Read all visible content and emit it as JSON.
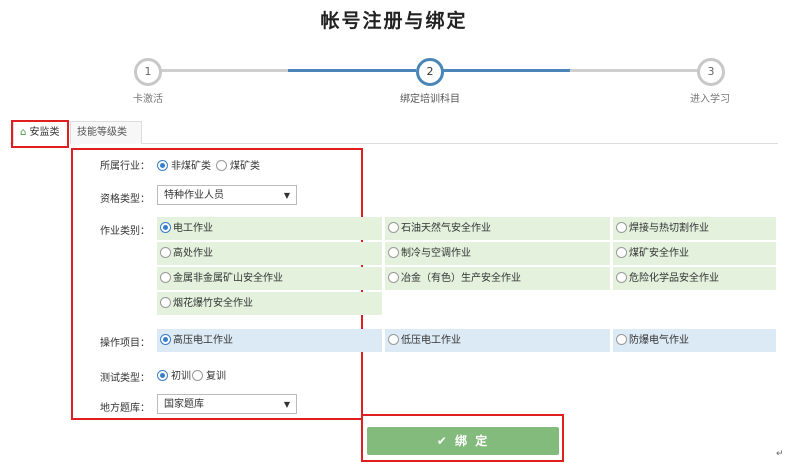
{
  "page": {
    "title": "帐号注册与绑定"
  },
  "steps": [
    {
      "num": "1",
      "label": "卡激活"
    },
    {
      "num": "2",
      "label": "绑定培训科目"
    },
    {
      "num": "3",
      "label": "进入学习"
    }
  ],
  "tabs": [
    {
      "label": "安监类",
      "icon": "home-icon"
    },
    {
      "label": "技能等级类"
    }
  ],
  "form": {
    "industry": {
      "label": "所属行业：",
      "options": [
        "非煤矿类",
        "煤矿类"
      ],
      "selected": "非煤矿类"
    },
    "qualification": {
      "label": "资格类型：",
      "value": "特种作业人员"
    },
    "job_category": {
      "label": "作业类别：",
      "options": [
        [
          "电工作业",
          "石油天然气安全作业",
          "焊接与热切割作业"
        ],
        [
          "高处作业",
          "制冷与空调作业",
          "煤矿安全作业"
        ],
        [
          "金属非金属矿山安全作业",
          "冶金（有色）生产安全作业",
          "危险化学品安全作业"
        ],
        [
          "烟花爆竹安全作业"
        ]
      ],
      "selected": "电工作业"
    },
    "operation": {
      "label": "操作项目：",
      "options": [
        "高压电工作业",
        "低压电工作业",
        "防爆电气作业"
      ],
      "selected": "高压电工作业"
    },
    "test_type": {
      "label": "测试类型：",
      "options": [
        "初训",
        "复训"
      ],
      "selected": "初训"
    },
    "question_bank": {
      "label": "地方题库：",
      "value": "国家题库"
    }
  },
  "button": {
    "label": "✔ 绑 定"
  },
  "misc": {
    "return_mark": "↵"
  },
  "colors": {
    "accent": "#4a86b8",
    "green_row": "#e3f1dd",
    "blue_row": "#dbeaf4",
    "button": "#83bb7c",
    "highlight": "#e02020"
  }
}
